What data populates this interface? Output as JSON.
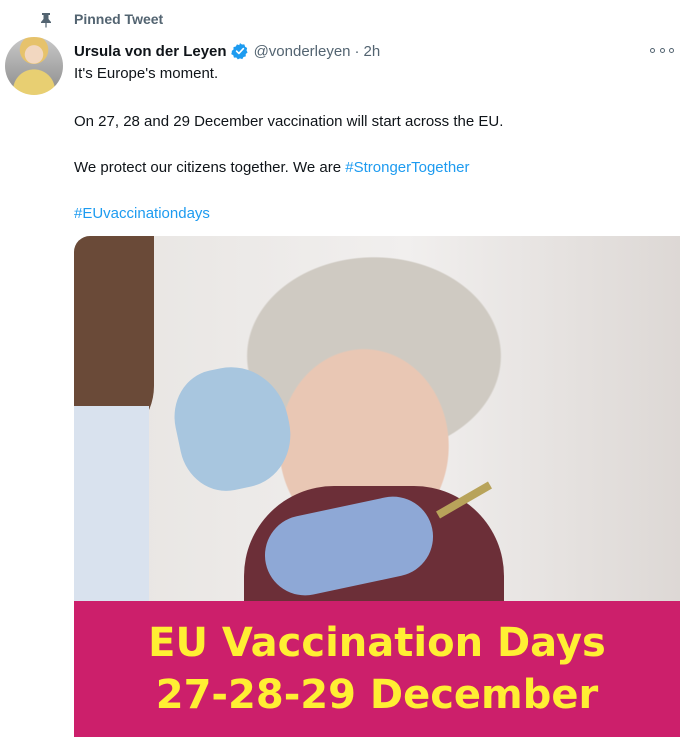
{
  "pinned": {
    "label": "Pinned Tweet",
    "icon": "pin-icon"
  },
  "author": {
    "name": "Ursula von der Leyen",
    "verified": true,
    "handle": "@vonderleyen",
    "separator": "·",
    "time": "2h"
  },
  "tweet": {
    "line1": "It's Europe's moment.",
    "line2": "On 27, 28 and 29 December vaccination will start across the EU.",
    "line3_prefix": "We protect our citizens together. We are ",
    "hashtag1": "#StrongerTogether",
    "hashtag2": "#EUvaccinationdays"
  },
  "media": {
    "banner_line1": "EU Vaccination Days",
    "banner_line2": "27-28-29 December",
    "banner_color": "#cc1f6b",
    "banner_text_color": "#ffef33"
  },
  "colors": {
    "link": "#1d9bf0",
    "muted": "#536471",
    "verified": "#1d9bf0"
  }
}
